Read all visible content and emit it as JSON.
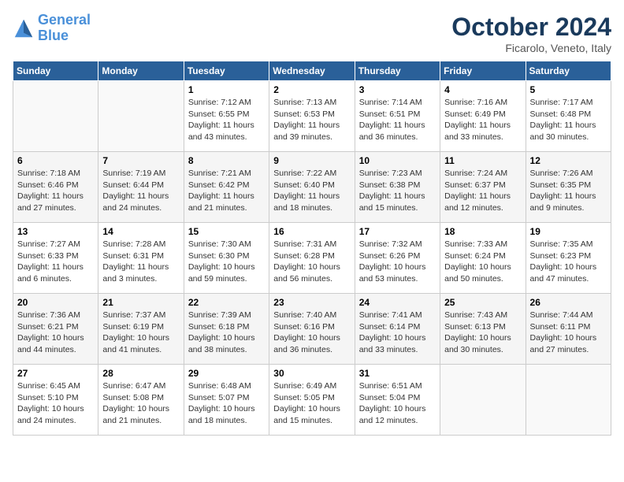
{
  "header": {
    "logo_general": "General",
    "logo_blue": "Blue",
    "month_title": "October 2024",
    "location": "Ficarolo, Veneto, Italy"
  },
  "calendar": {
    "days_of_week": [
      "Sunday",
      "Monday",
      "Tuesday",
      "Wednesday",
      "Thursday",
      "Friday",
      "Saturday"
    ],
    "weeks": [
      [
        {
          "day": "",
          "content": ""
        },
        {
          "day": "",
          "content": ""
        },
        {
          "day": "1",
          "content": "Sunrise: 7:12 AM\nSunset: 6:55 PM\nDaylight: 11 hours\nand 43 minutes."
        },
        {
          "day": "2",
          "content": "Sunrise: 7:13 AM\nSunset: 6:53 PM\nDaylight: 11 hours\nand 39 minutes."
        },
        {
          "day": "3",
          "content": "Sunrise: 7:14 AM\nSunset: 6:51 PM\nDaylight: 11 hours\nand 36 minutes."
        },
        {
          "day": "4",
          "content": "Sunrise: 7:16 AM\nSunset: 6:49 PM\nDaylight: 11 hours\nand 33 minutes."
        },
        {
          "day": "5",
          "content": "Sunrise: 7:17 AM\nSunset: 6:48 PM\nDaylight: 11 hours\nand 30 minutes."
        }
      ],
      [
        {
          "day": "6",
          "content": "Sunrise: 7:18 AM\nSunset: 6:46 PM\nDaylight: 11 hours\nand 27 minutes."
        },
        {
          "day": "7",
          "content": "Sunrise: 7:19 AM\nSunset: 6:44 PM\nDaylight: 11 hours\nand 24 minutes."
        },
        {
          "day": "8",
          "content": "Sunrise: 7:21 AM\nSunset: 6:42 PM\nDaylight: 11 hours\nand 21 minutes."
        },
        {
          "day": "9",
          "content": "Sunrise: 7:22 AM\nSunset: 6:40 PM\nDaylight: 11 hours\nand 18 minutes."
        },
        {
          "day": "10",
          "content": "Sunrise: 7:23 AM\nSunset: 6:38 PM\nDaylight: 11 hours\nand 15 minutes."
        },
        {
          "day": "11",
          "content": "Sunrise: 7:24 AM\nSunset: 6:37 PM\nDaylight: 11 hours\nand 12 minutes."
        },
        {
          "day": "12",
          "content": "Sunrise: 7:26 AM\nSunset: 6:35 PM\nDaylight: 11 hours\nand 9 minutes."
        }
      ],
      [
        {
          "day": "13",
          "content": "Sunrise: 7:27 AM\nSunset: 6:33 PM\nDaylight: 11 hours\nand 6 minutes."
        },
        {
          "day": "14",
          "content": "Sunrise: 7:28 AM\nSunset: 6:31 PM\nDaylight: 11 hours\nand 3 minutes."
        },
        {
          "day": "15",
          "content": "Sunrise: 7:30 AM\nSunset: 6:30 PM\nDaylight: 10 hours\nand 59 minutes."
        },
        {
          "day": "16",
          "content": "Sunrise: 7:31 AM\nSunset: 6:28 PM\nDaylight: 10 hours\nand 56 minutes."
        },
        {
          "day": "17",
          "content": "Sunrise: 7:32 AM\nSunset: 6:26 PM\nDaylight: 10 hours\nand 53 minutes."
        },
        {
          "day": "18",
          "content": "Sunrise: 7:33 AM\nSunset: 6:24 PM\nDaylight: 10 hours\nand 50 minutes."
        },
        {
          "day": "19",
          "content": "Sunrise: 7:35 AM\nSunset: 6:23 PM\nDaylight: 10 hours\nand 47 minutes."
        }
      ],
      [
        {
          "day": "20",
          "content": "Sunrise: 7:36 AM\nSunset: 6:21 PM\nDaylight: 10 hours\nand 44 minutes."
        },
        {
          "day": "21",
          "content": "Sunrise: 7:37 AM\nSunset: 6:19 PM\nDaylight: 10 hours\nand 41 minutes."
        },
        {
          "day": "22",
          "content": "Sunrise: 7:39 AM\nSunset: 6:18 PM\nDaylight: 10 hours\nand 38 minutes."
        },
        {
          "day": "23",
          "content": "Sunrise: 7:40 AM\nSunset: 6:16 PM\nDaylight: 10 hours\nand 36 minutes."
        },
        {
          "day": "24",
          "content": "Sunrise: 7:41 AM\nSunset: 6:14 PM\nDaylight: 10 hours\nand 33 minutes."
        },
        {
          "day": "25",
          "content": "Sunrise: 7:43 AM\nSunset: 6:13 PM\nDaylight: 10 hours\nand 30 minutes."
        },
        {
          "day": "26",
          "content": "Sunrise: 7:44 AM\nSunset: 6:11 PM\nDaylight: 10 hours\nand 27 minutes."
        }
      ],
      [
        {
          "day": "27",
          "content": "Sunrise: 6:45 AM\nSunset: 5:10 PM\nDaylight: 10 hours\nand 24 minutes."
        },
        {
          "day": "28",
          "content": "Sunrise: 6:47 AM\nSunset: 5:08 PM\nDaylight: 10 hours\nand 21 minutes."
        },
        {
          "day": "29",
          "content": "Sunrise: 6:48 AM\nSunset: 5:07 PM\nDaylight: 10 hours\nand 18 minutes."
        },
        {
          "day": "30",
          "content": "Sunrise: 6:49 AM\nSunset: 5:05 PM\nDaylight: 10 hours\nand 15 minutes."
        },
        {
          "day": "31",
          "content": "Sunrise: 6:51 AM\nSunset: 5:04 PM\nDaylight: 10 hours\nand 12 minutes."
        },
        {
          "day": "",
          "content": ""
        },
        {
          "day": "",
          "content": ""
        }
      ]
    ]
  }
}
